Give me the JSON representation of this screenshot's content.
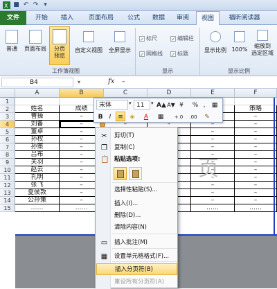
{
  "quick_access": [
    "save-icon",
    "undo-icon",
    "redo-icon",
    "customize-icon"
  ],
  "tabs": [
    "文件",
    "开始",
    "插入",
    "页面布局",
    "公式",
    "数据",
    "审阅",
    "视图",
    "福昕阅读器"
  ],
  "ribbon": {
    "workbook_views": {
      "buttons": [
        "普通",
        "页面布局",
        "分页\n预览",
        "自定义视图",
        "全屏显示"
      ],
      "label": "工作簿视图"
    },
    "show": {
      "checks": [
        {
          "label": "标尺",
          "checked": true
        },
        {
          "label": "编辑栏",
          "checked": true
        },
        {
          "label": "网格线",
          "checked": true
        },
        {
          "label": "标题",
          "checked": true
        }
      ],
      "label": "显示"
    },
    "zoom": {
      "buttons": [
        "显示比例",
        "100%",
        "缩放到\n选定区域"
      ],
      "label": "显示比例"
    }
  },
  "formula_bar": {
    "name_box": "B4",
    "fx": "fx",
    "value": "–"
  },
  "columns": [
    "A",
    "B",
    "C",
    "D",
    "E",
    "F"
  ],
  "rows": [
    "1",
    "2",
    "3",
    "4",
    "5",
    "6",
    "7",
    "8",
    "9",
    "10",
    "11",
    "12",
    "13",
    "14",
    "15"
  ],
  "sheet": {
    "headers": [
      "姓名",
      "成绩",
      "",
      "",
      "",
      "策略"
    ],
    "names": [
      "曹操",
      "刘备",
      "董卓",
      "孙权",
      "孙策",
      "吕布",
      "关羽",
      "赵云",
      "孔明",
      "张飞",
      "夏侯敦",
      "公孙策"
    ],
    "dash": "–",
    "ellipsis": "……",
    "watermark": "页"
  },
  "mini_toolbar": {
    "font": "宋体",
    "size": "11",
    "buttons": [
      "A▲",
      "A▼",
      "¥",
      "%",
      ",",
      "▦",
      "B",
      "I",
      "≡",
      "◈",
      "A",
      "▦",
      "+.0",
      ".00",
      "✎"
    ]
  },
  "context_menu": [
    {
      "label": "剪切(T)",
      "icon": "✂",
      "icon_name": "cut-icon",
      "disabled": false
    },
    {
      "label": "复制(C)",
      "icon": "❐",
      "icon_name": "copy-icon",
      "disabled": false
    },
    {
      "label": "粘贴选项:",
      "icon": "📋",
      "icon_name": "paste-icon",
      "disabled": false,
      "bold": true
    },
    {
      "label": "",
      "icon": "",
      "icon_name": "",
      "paste_row": true
    },
    {
      "label": "选择性粘贴(S)...",
      "icon": "",
      "icon_name": "",
      "disabled": false
    },
    {
      "label": "插入(I)...",
      "icon": "",
      "icon_name": "",
      "disabled": false
    },
    {
      "label": "删除(D)...",
      "icon": "",
      "icon_name": "",
      "disabled": false
    },
    {
      "label": "清除内容(N)",
      "icon": "",
      "icon_name": "",
      "disabled": false
    },
    {
      "label": "插入批注(M)",
      "icon": "▭",
      "icon_name": "comment-icon",
      "disabled": false
    },
    {
      "label": "设置单元格格式(F)...",
      "icon": "▦",
      "icon_name": "format-cells-icon",
      "disabled": false
    },
    {
      "label": "插入分页符(B)",
      "icon": "",
      "icon_name": "",
      "disabled": false,
      "highlighted": true
    },
    {
      "label": "重设所有分页符(A)",
      "icon": "",
      "icon_name": "",
      "disabled": true
    }
  ]
}
